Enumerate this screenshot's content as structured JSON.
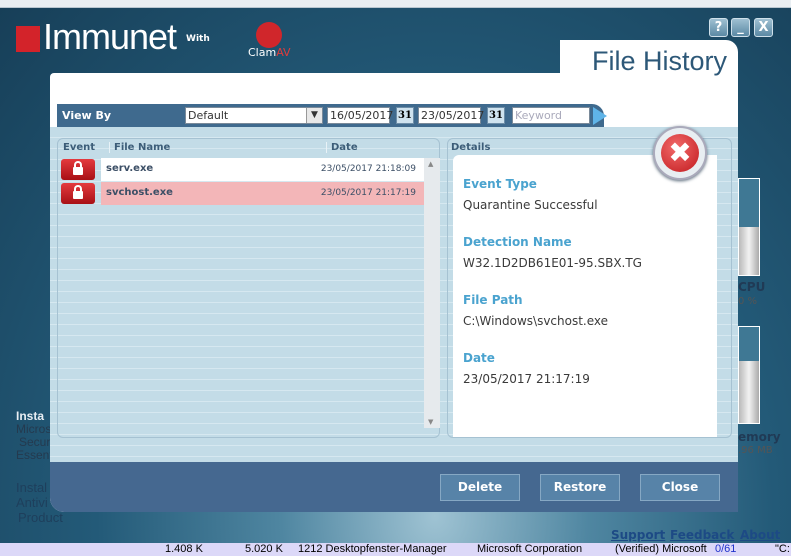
{
  "app": {
    "logo_name": "Immunet",
    "logo_with": "With",
    "partner": "Clam",
    "partner_suffix": "AV"
  },
  "window": {
    "help": "?",
    "minimize": "_",
    "close": "X"
  },
  "dialog": {
    "title": "File History",
    "view_by_label": "View By",
    "view_by_value": "Default",
    "date_from": "16/05/2017",
    "date_to": "23/05/2017",
    "calendar_label": "31",
    "keyword_placeholder": "Keyword",
    "columns": {
      "event": "Event",
      "file_name": "File Name",
      "date": "Date"
    },
    "rows": [
      {
        "file": "serv.exe",
        "date": "23/05/2017 21:18:09",
        "selected": false
      },
      {
        "file": "svchost.exe",
        "date": "23/05/2017 21:17:19",
        "selected": true
      }
    ],
    "details_title": "Details",
    "details": [
      {
        "label": "Event Type",
        "value": "Quarantine Successful"
      },
      {
        "label": "Detection Name",
        "value": "W32.1D2DB61E01-95.SBX.TG"
      },
      {
        "label": "File Path",
        "value": "C:\\Windows\\svchost.exe"
      },
      {
        "label": "Date",
        "value": "23/05/2017 21:17:19"
      }
    ],
    "buttons": {
      "delete": "Delete",
      "restore": "Restore",
      "close": "Close"
    }
  },
  "background": {
    "side1": [
      "Insta",
      "Micros",
      "Secur",
      "Essent"
    ],
    "side2": [
      "Instal",
      "Antivi",
      "Product"
    ],
    "cpu_label": "CPU",
    "cpu_value": "0 %",
    "cpu_fraction": 0.5,
    "mem_label": "emory",
    "mem_value": ".96 MB",
    "mem_fraction": 0.65,
    "links": {
      "support": "Support",
      "feedback": "Feedback",
      "about": "About"
    }
  },
  "process_row": {
    "c1": "1.408 K",
    "c2": "5.020 K",
    "c3": "1212 Desktopfenster-Manager",
    "c4": "Microsoft Corporation",
    "c5": "(Verified) Microsoft",
    "c6": "0/61",
    "c7": "\"C:"
  }
}
